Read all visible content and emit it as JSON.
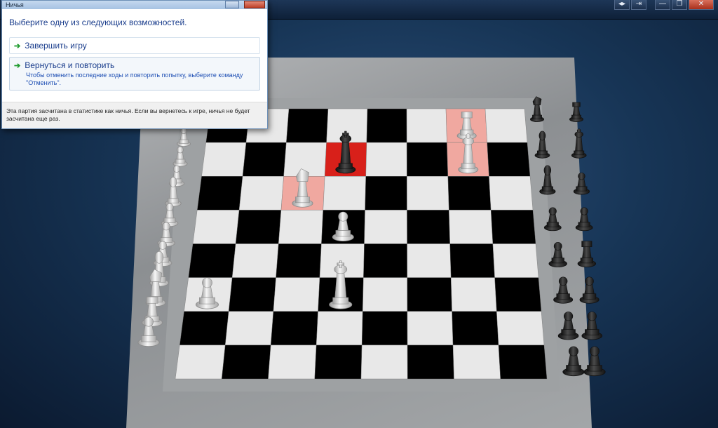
{
  "window": {
    "controls": [
      "◂▸",
      "⇥",
      "—",
      "❐",
      "✕"
    ]
  },
  "dialog": {
    "title": "Ничья",
    "heading": "Выберите одну из следующих возможностей.",
    "options": [
      {
        "label": "Завершить игру",
        "description": ""
      },
      {
        "label": "Вернуться и повторить",
        "description": "Чтобы отменить последние ходы и повторить попытку, выберите команду \"Отменить\"."
      }
    ],
    "footer": "Эта партия засчитана в статистике как ничья. Если вы вернетесь к игре, ничья не будет засчитана еще раз."
  },
  "board": {
    "files": 8,
    "ranks": 8,
    "highlight_color": "#f0a8a0",
    "check_color": "#d8201a",
    "light_square": "#e8e8e8",
    "dark_square": "#000000",
    "pieces_on_board": [
      {
        "piece": "king",
        "color": "black",
        "square": [
          4,
          7
        ],
        "state": "check"
      },
      {
        "piece": "rook",
        "color": "white",
        "square": [
          7,
          8
        ],
        "state": "highlighted"
      },
      {
        "piece": "queen",
        "color": "white",
        "square": [
          7,
          7
        ],
        "state": "highlighted"
      },
      {
        "piece": "knight",
        "color": "white",
        "square": [
          3,
          6
        ],
        "state": "highlighted"
      },
      {
        "piece": "pawn",
        "color": "white",
        "square": [
          4,
          5
        ],
        "state": "normal"
      },
      {
        "piece": "king",
        "color": "white",
        "square": [
          4,
          3
        ],
        "state": "normal"
      },
      {
        "piece": "pawn",
        "color": "white",
        "square": [
          1,
          3
        ],
        "state": "normal"
      }
    ]
  },
  "captured": {
    "white_side": [
      "pawn",
      "pawn",
      "pawn",
      "bishop",
      "pawn",
      "pawn",
      "pawn",
      "bishop",
      "knight",
      "rook",
      "pawn"
    ],
    "black_side": [
      "knight",
      "rook",
      "bishop",
      "queen",
      "bishop",
      "pawn",
      "pawn",
      "pawn",
      "pawn",
      "rook",
      "pawn",
      "pawn",
      "pawn",
      "pawn",
      "pawn",
      "pawn"
    ]
  }
}
